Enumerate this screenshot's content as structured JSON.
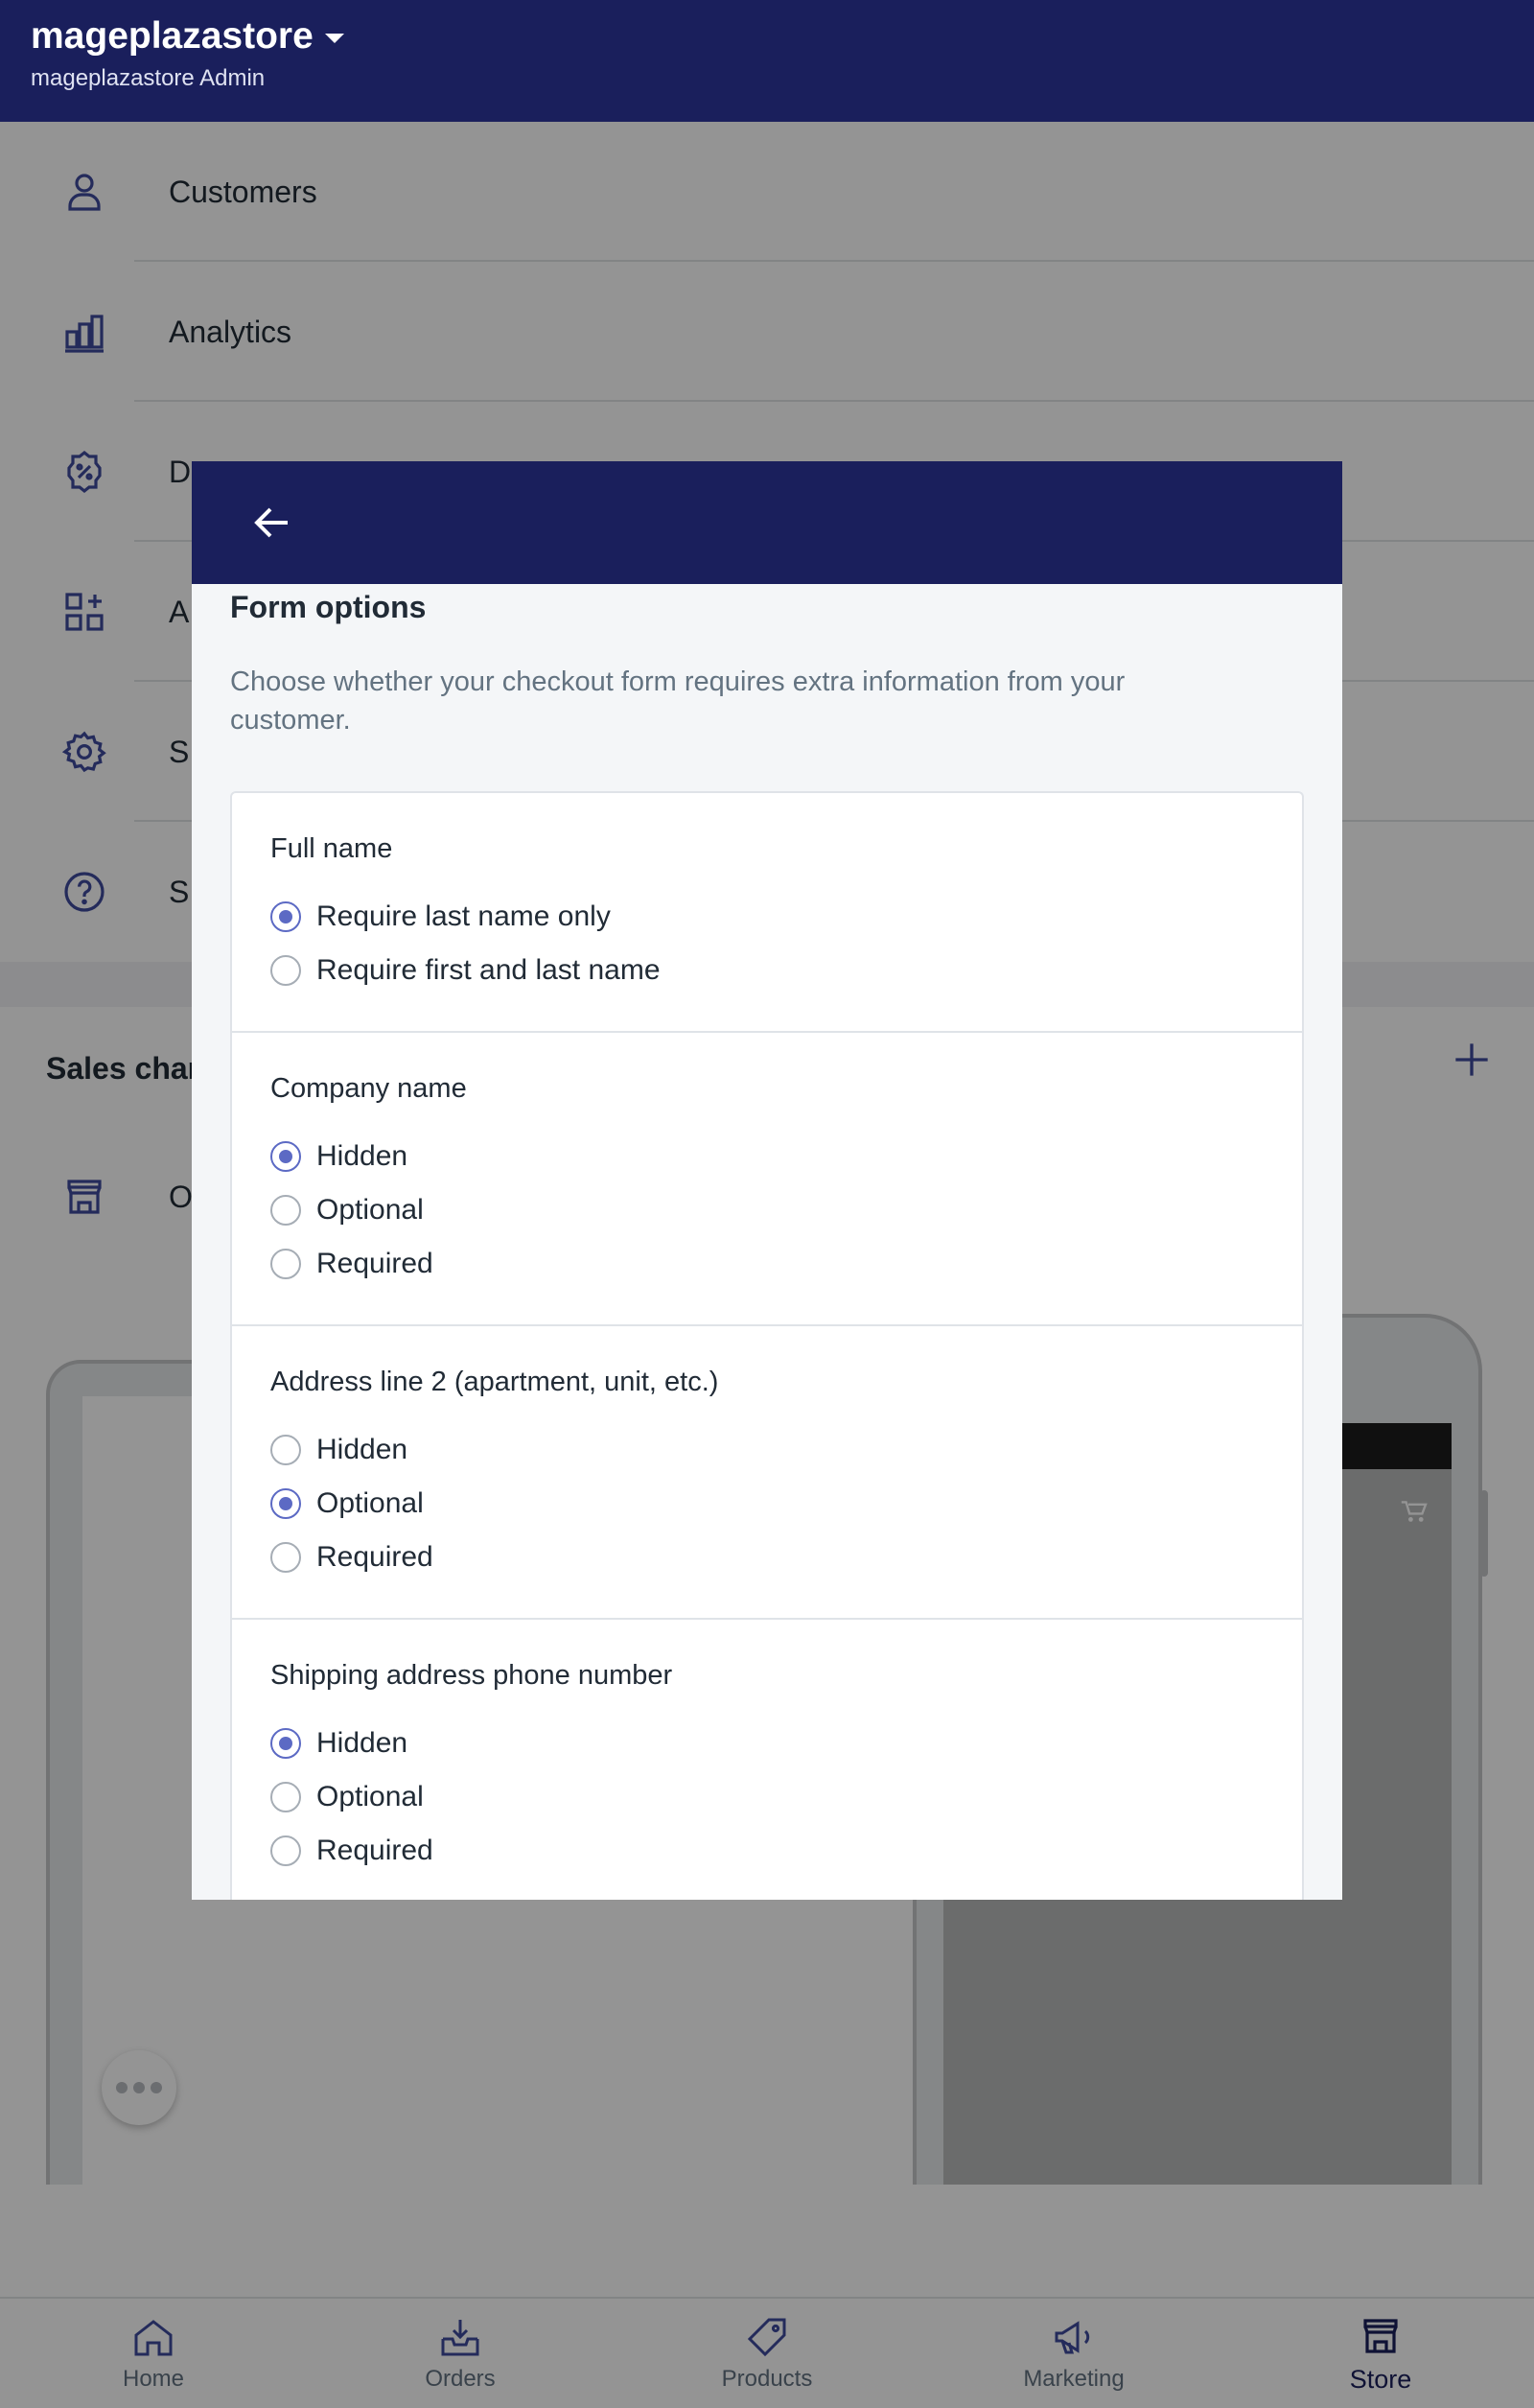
{
  "topbar": {
    "store_name": "mageplazastore",
    "store_sub": "mageplazastore Admin"
  },
  "menu": {
    "items": [
      {
        "label": "Customers",
        "icon": "customer-icon"
      },
      {
        "label": "Analytics",
        "icon": "analytics-icon"
      },
      {
        "label": "D",
        "icon": "discount-icon"
      },
      {
        "label": "A",
        "icon": "apps-icon"
      },
      {
        "label": "S",
        "icon": "settings-icon"
      },
      {
        "label": "S",
        "icon": "help-icon"
      }
    ]
  },
  "sales": {
    "title": "Sales chan",
    "online_label": "O"
  },
  "modal": {
    "title": "Form options",
    "description": "Choose whether your checkout form requires extra information from your customer.",
    "sections": [
      {
        "title": "Full name",
        "options": [
          "Require last name only",
          "Require first and last name"
        ],
        "selected": "Require last name only"
      },
      {
        "title": "Company name",
        "options": [
          "Hidden",
          "Optional",
          "Required"
        ],
        "selected": "Hidden"
      },
      {
        "title": "Address line 2 (apartment, unit, etc.)",
        "options": [
          "Hidden",
          "Optional",
          "Required"
        ],
        "selected": "Optional"
      },
      {
        "title": "Shipping address phone number",
        "options": [
          "Hidden",
          "Optional",
          "Required"
        ],
        "selected": "Hidden"
      }
    ]
  },
  "bottom_nav": {
    "items": [
      {
        "label": "Home",
        "icon": "home-icon"
      },
      {
        "label": "Orders",
        "icon": "orders-icon"
      },
      {
        "label": "Products",
        "icon": "products-icon"
      },
      {
        "label": "Marketing",
        "icon": "marketing-icon"
      },
      {
        "label": "Store",
        "icon": "store-icon"
      }
    ],
    "active": "Store"
  },
  "colors": {
    "brand_navy": "#1a1f5c",
    "accent": "#5c6ac4",
    "icon": "#3f4a9e"
  }
}
